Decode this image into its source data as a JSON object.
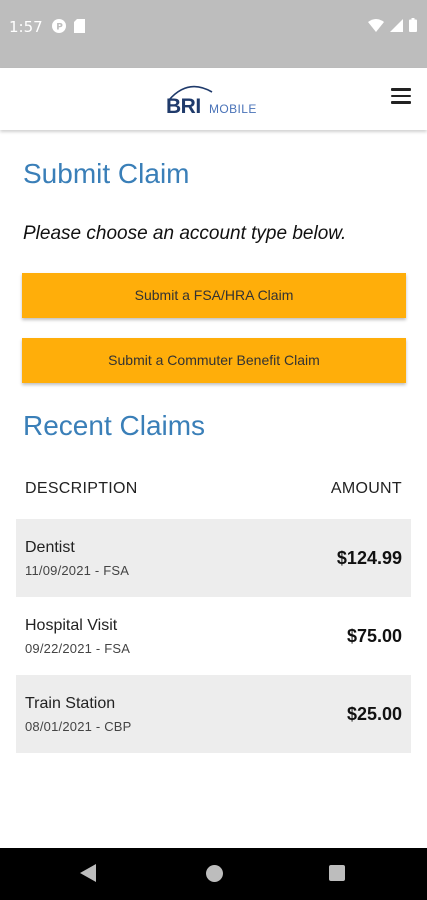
{
  "status_bar": {
    "time": "1:57",
    "left_icons": [
      "app-notification-icon",
      "sd-card-icon"
    ],
    "right_icons": [
      "wifi-icon",
      "cell-signal-icon",
      "battery-icon"
    ]
  },
  "header": {
    "logo_text": "BRI",
    "logo_subtext": "MOBILE",
    "menu_icon": "hamburger-menu-icon"
  },
  "submit_claim": {
    "title": "Submit Claim",
    "instructions": "Please choose an account type below.",
    "buttons": [
      {
        "label": "Submit a FSA/HRA Claim"
      },
      {
        "label": "Submit a Commuter Benefit Claim"
      }
    ]
  },
  "recent_claims": {
    "title": "Recent Claims",
    "columns": {
      "description": "DESCRIPTION",
      "amount": "AMOUNT"
    },
    "rows": [
      {
        "description": "Dentist",
        "meta": "11/09/2021 - FSA",
        "amount": "$124.99"
      },
      {
        "description": "Hospital Visit",
        "meta": "09/22/2021 - FSA",
        "amount": "$75.00"
      },
      {
        "description": "Train Station",
        "meta": "08/01/2021 - CBP",
        "amount": "$25.00"
      }
    ]
  },
  "nav_bar": {
    "icons": [
      "back-icon",
      "home-icon",
      "recents-icon"
    ]
  },
  "colors": {
    "accent_blue": "#3a7fb8",
    "button_orange": "#ffae0a",
    "row_shade": "#ededed",
    "status_bar": "#bdbdbd"
  }
}
